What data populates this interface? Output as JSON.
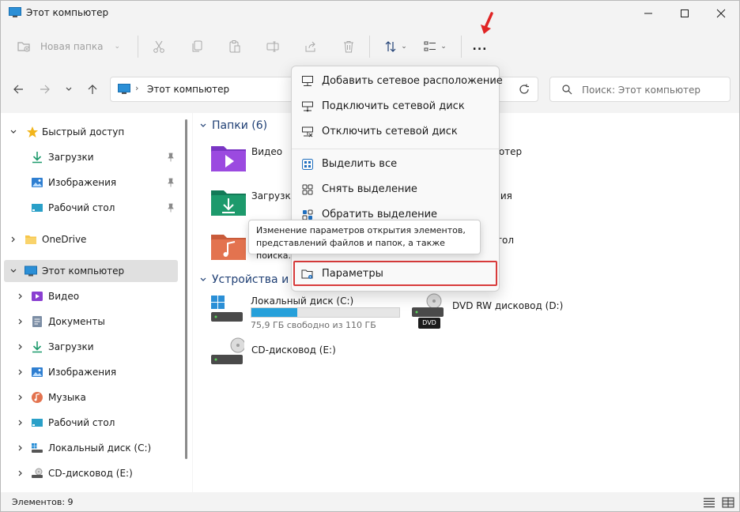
{
  "window": {
    "title": "Этот компьютер"
  },
  "toolbar": {
    "new_folder_label": "Новая папка",
    "more_label": "..."
  },
  "address": {
    "path": "Этот компьютер",
    "search_placeholder": "Поиск: Этот компьютер"
  },
  "sidebar": {
    "items": [
      {
        "label": "Быстрый доступ",
        "icon": "star-icon"
      },
      {
        "label": "Загрузки",
        "icon": "download-icon"
      },
      {
        "label": "Изображения",
        "icon": "image-icon"
      },
      {
        "label": "Рабочий стол",
        "icon": "desktop-icon"
      },
      {
        "label": "OneDrive",
        "icon": "folder-icon"
      },
      {
        "label": "Этот компьютер",
        "icon": "pc-icon"
      },
      {
        "label": "Видео",
        "icon": "video-icon"
      },
      {
        "label": "Документы",
        "icon": "document-icon"
      },
      {
        "label": "Загрузки",
        "icon": "download-icon"
      },
      {
        "label": "Изображения",
        "icon": "image-icon"
      },
      {
        "label": "Музыка",
        "icon": "music-icon"
      },
      {
        "label": "Рабочий стол",
        "icon": "desktop-icon"
      },
      {
        "label": "Локальный диск (C:)",
        "icon": "drive-icon"
      },
      {
        "label": "CD-дисковод (E:)",
        "icon": "cd-drive-icon"
      }
    ]
  },
  "main": {
    "folders_header": "Папки (6)",
    "folders": [
      {
        "label": "Видео"
      },
      {
        "label": "Загрузки"
      }
    ],
    "devices_header": "Устройства и д",
    "drives": [
      {
        "label": "Локальный диск (C:)",
        "sub": "75,9 ГБ свободно из 110 ГБ",
        "used_fraction": 0.31
      },
      {
        "label": "DVD RW дисковод (D:)",
        "badge": "DVD"
      },
      {
        "label": "CD-дисковод (E:)"
      }
    ],
    "partials": [
      "ьютер",
      "ния",
      "тол"
    ]
  },
  "menu": {
    "items": [
      {
        "label": "Добавить сетевое расположение"
      },
      {
        "label": "Подключить сетевой диск"
      },
      {
        "label": "Отключить сетевой диск"
      },
      {
        "label": "Выделить все"
      },
      {
        "label": "Снять выделение"
      },
      {
        "label": "Обратить выделение"
      },
      {
        "label": "Параметры"
      }
    ]
  },
  "tooltip": {
    "text": "Изменение параметров открытия элементов, представлений файлов и папок, а также поиска."
  },
  "status": {
    "count": "Элементов: 9"
  },
  "colors": {
    "accent": "#0067c0",
    "highlight": "#d83b3b",
    "header": "#1f3f74",
    "progress": "#26a0da"
  }
}
